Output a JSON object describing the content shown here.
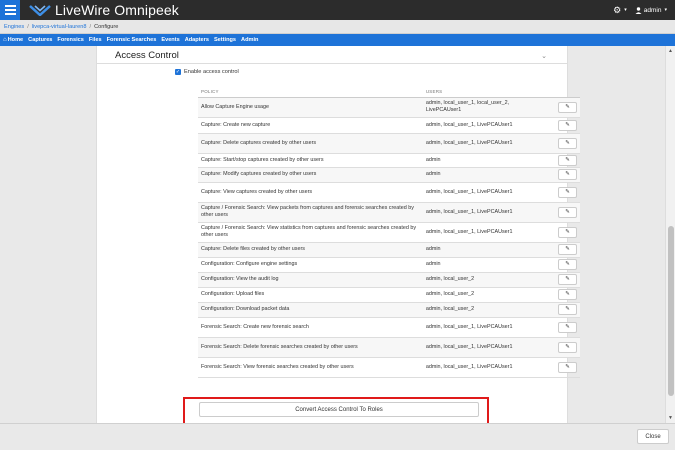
{
  "app": {
    "title": "LiveWire Omnipeek",
    "user": "admin"
  },
  "breadcrumb": {
    "root": "Engines",
    "engine": "livepca-virtual-lauren8",
    "current": "Configure"
  },
  "nav": [
    "Home",
    "Captures",
    "Forensics",
    "Files",
    "Forensic Searches",
    "Events",
    "Adapters",
    "Settings",
    "Admin"
  ],
  "section": {
    "title": "Access Control",
    "enable_label": "Enable access control",
    "enable_checked": true
  },
  "table": {
    "headers": {
      "policy": "POLICY",
      "users": "USERS"
    },
    "rows": [
      {
        "policy": "Allow Capture Engine usage",
        "users": "admin, local_user_1, local_user_2, LivePCAUser1"
      },
      {
        "policy": "Capture: Create new capture",
        "users": "admin, local_user_1, LivePCAUser1"
      },
      {
        "policy": "Capture: Delete captures created by other users",
        "users": "admin, local_user_1, LivePCAUser1"
      },
      {
        "policy": "Capture: Start/stop captures created by other users",
        "users": "admin"
      },
      {
        "policy": "Capture: Modify captures created by other users",
        "users": "admin"
      },
      {
        "policy": "Capture: View captures created by other users",
        "users": "admin, local_user_1, LivePCAUser1"
      },
      {
        "policy": "Capture / Forensic Search: View packets from captures and forensic searches created by other users",
        "users": "admin, local_user_1, LivePCAUser1"
      },
      {
        "policy": "Capture / Forensic Search: View statistics from captures and forensic searches created by other users",
        "users": "admin, local_user_1, LivePCAUser1"
      },
      {
        "policy": "Capture: Delete files created by other users",
        "users": "admin"
      },
      {
        "policy": "Configuration: Configure engine settings",
        "users": "admin"
      },
      {
        "policy": "Configuration: View the audit log",
        "users": "admin, local_user_2"
      },
      {
        "policy": "Configuration: Upload files",
        "users": "admin, local_user_2"
      },
      {
        "policy": "Configuration: Download packet data",
        "users": "admin, local_user_2"
      },
      {
        "policy": "Forensic Search: Create new forensic search",
        "users": "admin, local_user_1, LivePCAUser1"
      },
      {
        "policy": "Forensic Search: Delete forensic searches created by other users",
        "users": "admin, local_user_1, LivePCAUser1"
      },
      {
        "policy": "Forensic Search: View forensic searches created by other users",
        "users": "admin, local_user_1, LivePCAUser1"
      }
    ]
  },
  "buttons": {
    "convert": "Convert Access Control To Roles",
    "close": "Close"
  },
  "icons": {
    "menu": "hamburger-icon",
    "settings": "gear-icon",
    "user": "user-icon",
    "edit": "pencil-icon",
    "home": "home-icon"
  },
  "colors": {
    "brand": "#1e73d8",
    "highlight": "#e01a1a"
  }
}
